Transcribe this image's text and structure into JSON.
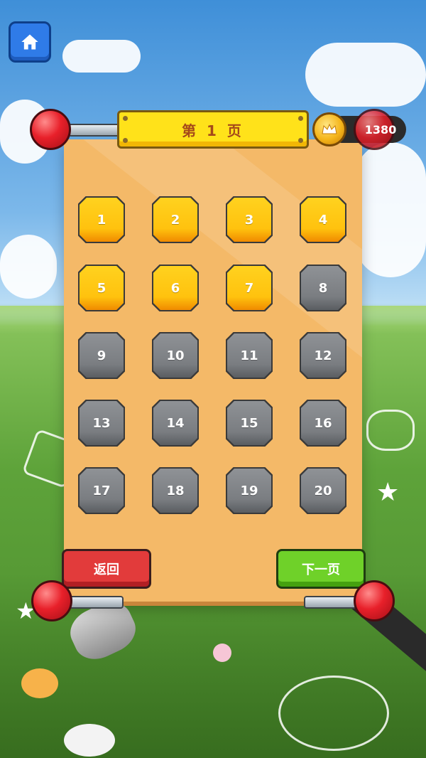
{
  "header": {
    "home_icon": "home-icon",
    "page_title": "第 1 页",
    "coins": "1380",
    "coin_icon": "crown-coin-icon"
  },
  "levels": [
    {
      "label": "1",
      "locked": false
    },
    {
      "label": "2",
      "locked": false
    },
    {
      "label": "3",
      "locked": false
    },
    {
      "label": "4",
      "locked": false
    },
    {
      "label": "5",
      "locked": false
    },
    {
      "label": "6",
      "locked": false
    },
    {
      "label": "7",
      "locked": false
    },
    {
      "label": "8",
      "locked": true
    },
    {
      "label": "9",
      "locked": true
    },
    {
      "label": "10",
      "locked": true
    },
    {
      "label": "11",
      "locked": true
    },
    {
      "label": "12",
      "locked": true
    },
    {
      "label": "13",
      "locked": true
    },
    {
      "label": "14",
      "locked": true
    },
    {
      "label": "15",
      "locked": true
    },
    {
      "label": "16",
      "locked": true
    },
    {
      "label": "17",
      "locked": true
    },
    {
      "label": "18",
      "locked": true
    },
    {
      "label": "19",
      "locked": true
    },
    {
      "label": "20",
      "locked": true
    }
  ],
  "footer": {
    "back_label": "返回",
    "next_label": "下一页"
  },
  "colors": {
    "unlocked": "#ffc20e",
    "locked": "#7a7d81",
    "back_button": "#e23b3b",
    "next_button": "#6fd129",
    "panel": "#f4b968",
    "title_plate": "#ffe21a"
  }
}
